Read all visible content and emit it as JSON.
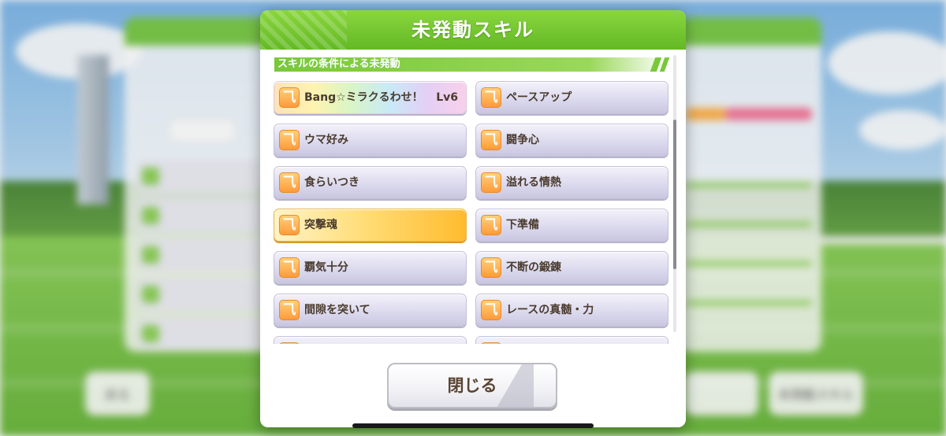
{
  "dialog": {
    "title": "未発動スキル",
    "section_label": "スキルの条件による未発動",
    "close_label": "閉じる"
  },
  "skills": [
    {
      "name": "Bang☆ミラクるわせ！",
      "level": "Lv6",
      "style": "rainbow"
    },
    {
      "name": "ペースアップ",
      "style": "normal"
    },
    {
      "name": "ウマ好み",
      "style": "normal"
    },
    {
      "name": "闘争心",
      "style": "normal"
    },
    {
      "name": "食らいつき",
      "style": "normal"
    },
    {
      "name": "溢れる情熱",
      "style": "normal"
    },
    {
      "name": "突撃魂",
      "style": "gold"
    },
    {
      "name": "下準備",
      "style": "normal"
    },
    {
      "name": "覇気十分",
      "style": "normal"
    },
    {
      "name": "不断の鍛錬",
      "style": "normal"
    },
    {
      "name": "間隙を突いて",
      "style": "normal"
    },
    {
      "name": "レースの真髄・力",
      "style": "normal"
    }
  ],
  "background": {
    "back_button": "戻る",
    "unactivated_skill_button": "未発動スキル"
  },
  "colors": {
    "header_green": "#63b925",
    "accent_orange": "#ff9b3a",
    "text_brown": "#4a3b2e"
  },
  "icons": {
    "skill": "running-umamusume-icon"
  }
}
